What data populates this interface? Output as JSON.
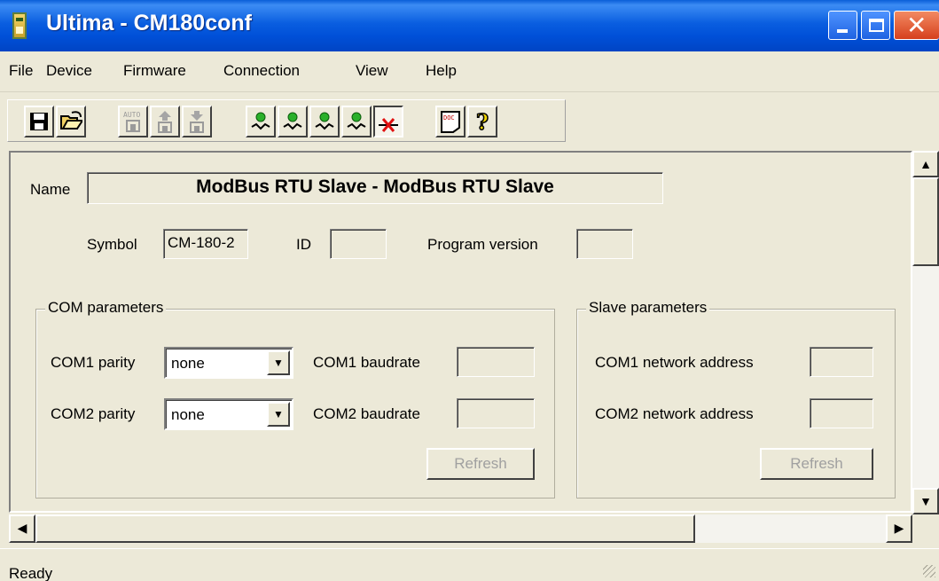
{
  "window": {
    "title": "Ultima - CM180conf"
  },
  "menu": [
    "File",
    "Device",
    "Firmware",
    "Connection",
    "View",
    "Help"
  ],
  "toolbar": {
    "buttons": [
      {
        "icon": "save-icon"
      },
      {
        "icon": "open-folder-icon"
      },
      {
        "icon": "auto-icon",
        "text": "AUTO"
      },
      {
        "icon": "upload-icon"
      },
      {
        "icon": "download-icon"
      },
      {
        "icon": "connect-1-icon"
      },
      {
        "icon": "connect-2-icon"
      },
      {
        "icon": "connect-3-icon"
      },
      {
        "icon": "connect-4-icon"
      },
      {
        "icon": "disconnect-icon"
      },
      {
        "icon": "doc-icon",
        "text": "DOC"
      },
      {
        "icon": "help-icon"
      }
    ]
  },
  "device": {
    "name_label": "Name",
    "name_value": "ModBus RTU Slave - ModBus RTU Slave",
    "symbol_label": "Symbol",
    "symbol_value": "CM-180-2",
    "id_label": "ID",
    "id_value": "",
    "program_version_label": "Program version",
    "program_version_value": ""
  },
  "com_params": {
    "title": "COM parameters",
    "com1_parity_label": "COM1 parity",
    "com1_parity_value": "none",
    "com2_parity_label": "COM2 parity",
    "com2_parity_value": "none",
    "com1_baudrate_label": "COM1 baudrate",
    "com1_baudrate_value": "",
    "com2_baudrate_label": "COM2 baudrate",
    "com2_baudrate_value": "",
    "refresh_label": "Refresh"
  },
  "slave_params": {
    "title": "Slave parameters",
    "com1_address_label": "COM1 network address",
    "com1_address_value": "",
    "com2_address_label": "COM2 network address",
    "com2_address_value": "",
    "refresh_label": "Refresh"
  },
  "status": {
    "text": "Ready"
  },
  "colors": {
    "titlebar": "#0a5ee0",
    "face": "#ece9d8",
    "close": "#d6401d",
    "disabled_text": "#a0a0a0"
  }
}
